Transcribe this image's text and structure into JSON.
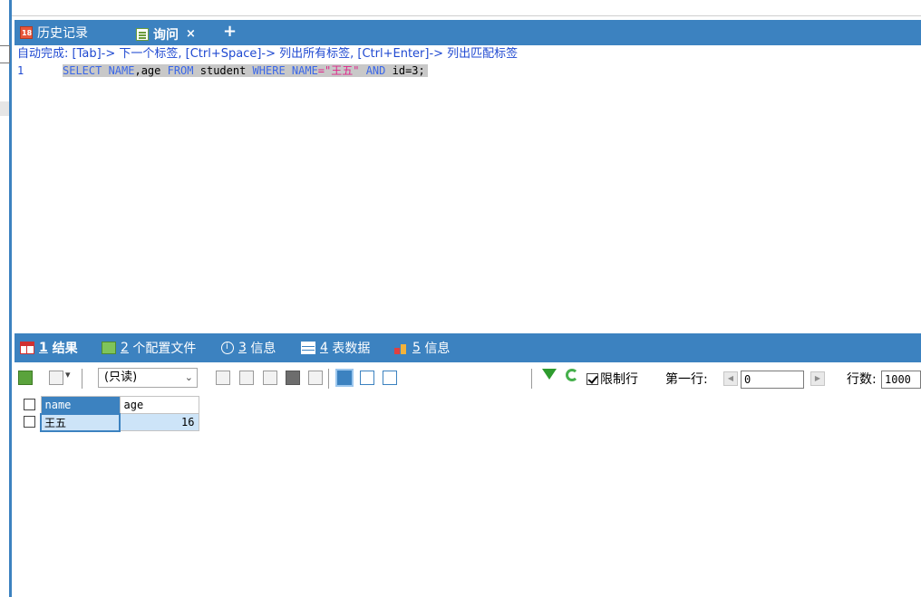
{
  "tabs": {
    "history_label": "历史记录",
    "query_label": "询问",
    "close_glyph": "×",
    "add_glyph": "+"
  },
  "editor": {
    "hint": "自动完成: [Tab]-> 下一个标签, [Ctrl+Space]-> 列出所有标签, [Ctrl+Enter]-> 列出匹配标签",
    "line_number": "1",
    "sql": {
      "t1": "SELECT NAME",
      "t2": ",age ",
      "t3": "FROM",
      "t4": " student ",
      "t5": "WHERE NAME",
      "t6": "=\"王五\"",
      "t7": " AND",
      "t8": " id=3;"
    }
  },
  "result_tabs": [
    {
      "num": "1",
      "label": "结果"
    },
    {
      "num": "2",
      "label": "个配置文件"
    },
    {
      "num": "3",
      "label": "信息"
    },
    {
      "num": "4",
      "label": "表数据"
    },
    {
      "num": "5",
      "label": "信息"
    }
  ],
  "toolbar": {
    "mode": "(只读)",
    "limit_label": "限制行",
    "first_row_label": "第一行:",
    "first_row_value": "0",
    "rows_label": "行数:",
    "rows_value": "1000"
  },
  "grid": {
    "columns": [
      "name",
      "age"
    ],
    "rows": [
      {
        "name": "王五",
        "age": "16"
      }
    ]
  },
  "colors": {
    "accent": "#3c82c0",
    "keyword": "#3a67e8",
    "string": "#e0248a"
  }
}
